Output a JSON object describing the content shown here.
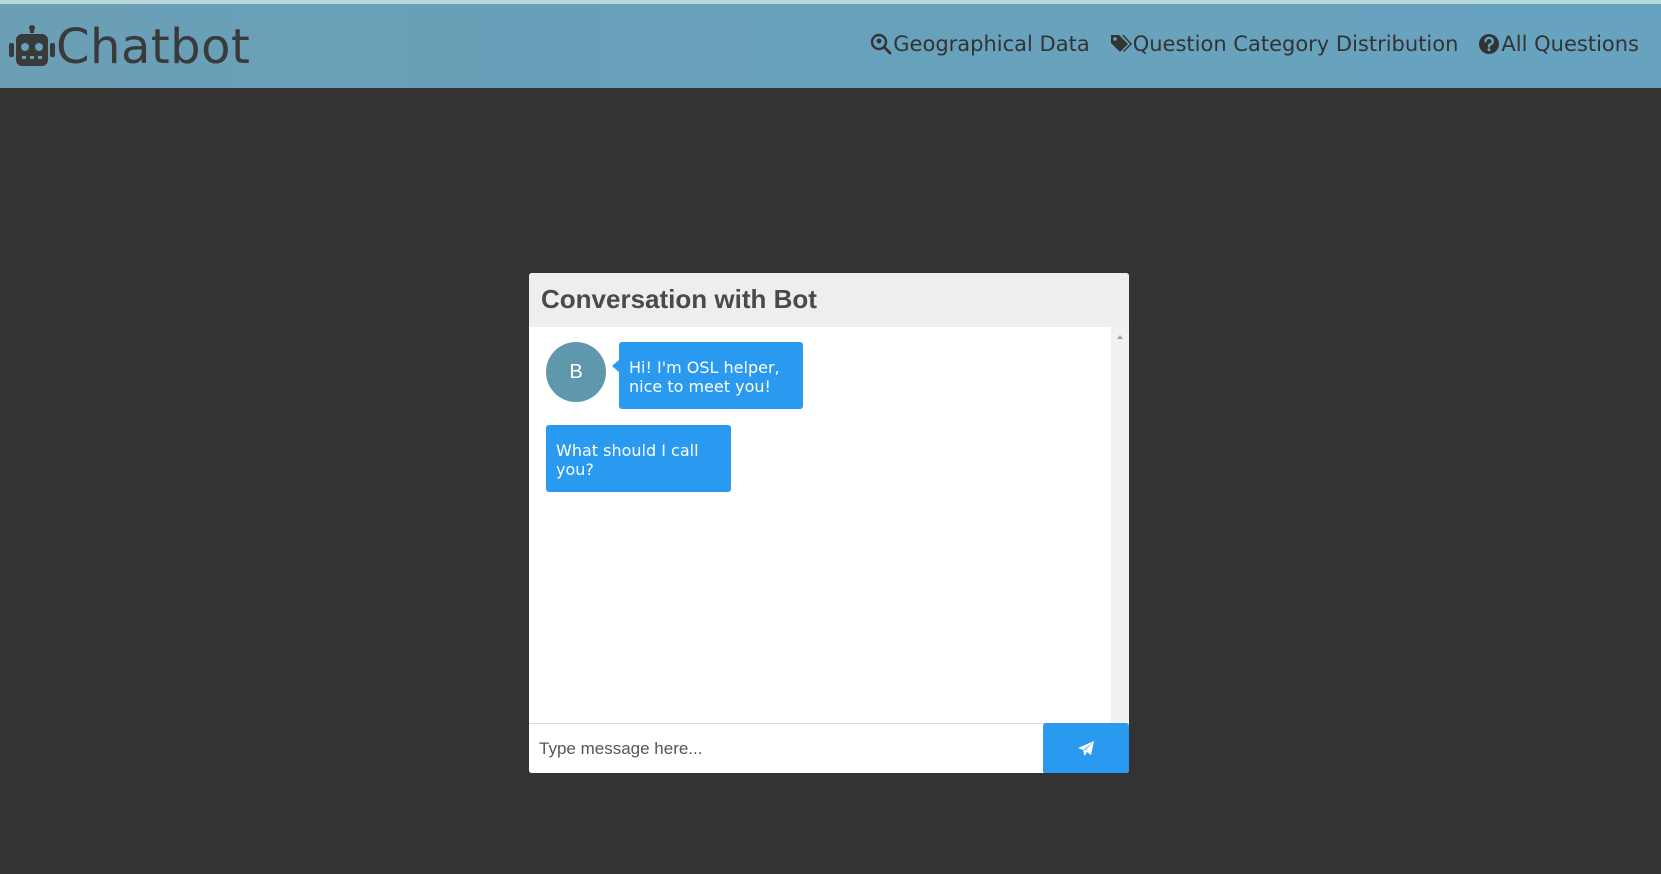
{
  "app": {
    "brand": "Chatbot",
    "brand_icon": "robot-icon"
  },
  "nav": {
    "items": [
      {
        "label": "Geographical Data",
        "icon": "map-search-icon"
      },
      {
        "label": "Question Category Distribution",
        "icon": "tags-icon"
      },
      {
        "label": "All Questions",
        "icon": "question-circle-icon"
      }
    ]
  },
  "chat": {
    "title": "Conversation with Bot",
    "avatar_letter": "B",
    "messages": [
      {
        "text": "Hi! I'm OSL helper, nice to meet you!"
      },
      {
        "text": "What should I call you?"
      }
    ],
    "input_value": "",
    "input_placeholder": "Type message here...",
    "send_icon": "paper-plane-icon"
  },
  "colors": {
    "navbar": "#67a3bf",
    "background": "#333333",
    "bubble": "#2a9af0",
    "avatar": "#5f97ad",
    "send_button": "#2a9af0"
  }
}
